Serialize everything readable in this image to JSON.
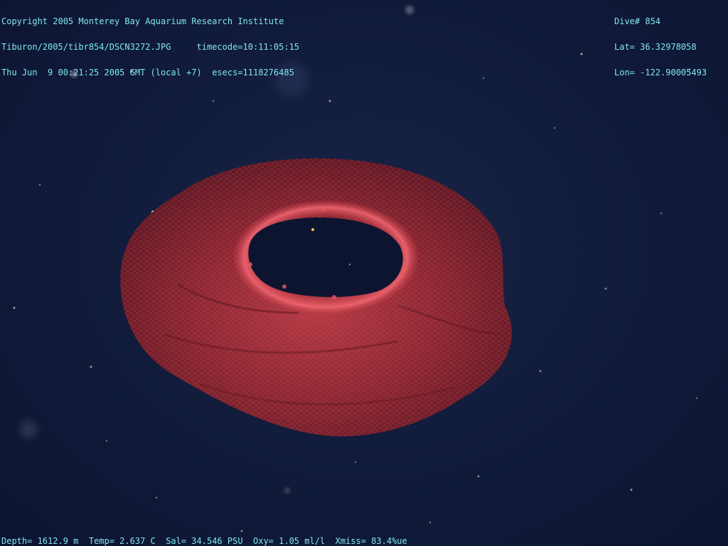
{
  "overlay": {
    "top_left": [
      "Copyright 2005 Monterey Bay Aquarium Research Institute",
      "Tiburon/2005/tibr854/DSCN3272.JPG     timecode=10:11:05:15",
      "Thu Jun  9 00:21:25 2005 GMT (local +7)  esecs=1118276485"
    ],
    "top_right": [
      "Dive# 854",
      "Lat= 36.32978058",
      "Lon= -122.90005493"
    ],
    "bottom": "Depth= 1612.9 m  Temp= 2.637 C  Sal= 34.546 PSU  Oxy= 1.05 ml/l  Xmiss= 83.4%ue"
  },
  "scene": {
    "subject": "red-ring-shaped-jellyfish",
    "background_color": "#121c3c",
    "subject_color": "#8e2a33",
    "text_color": "#7fe6f2"
  }
}
